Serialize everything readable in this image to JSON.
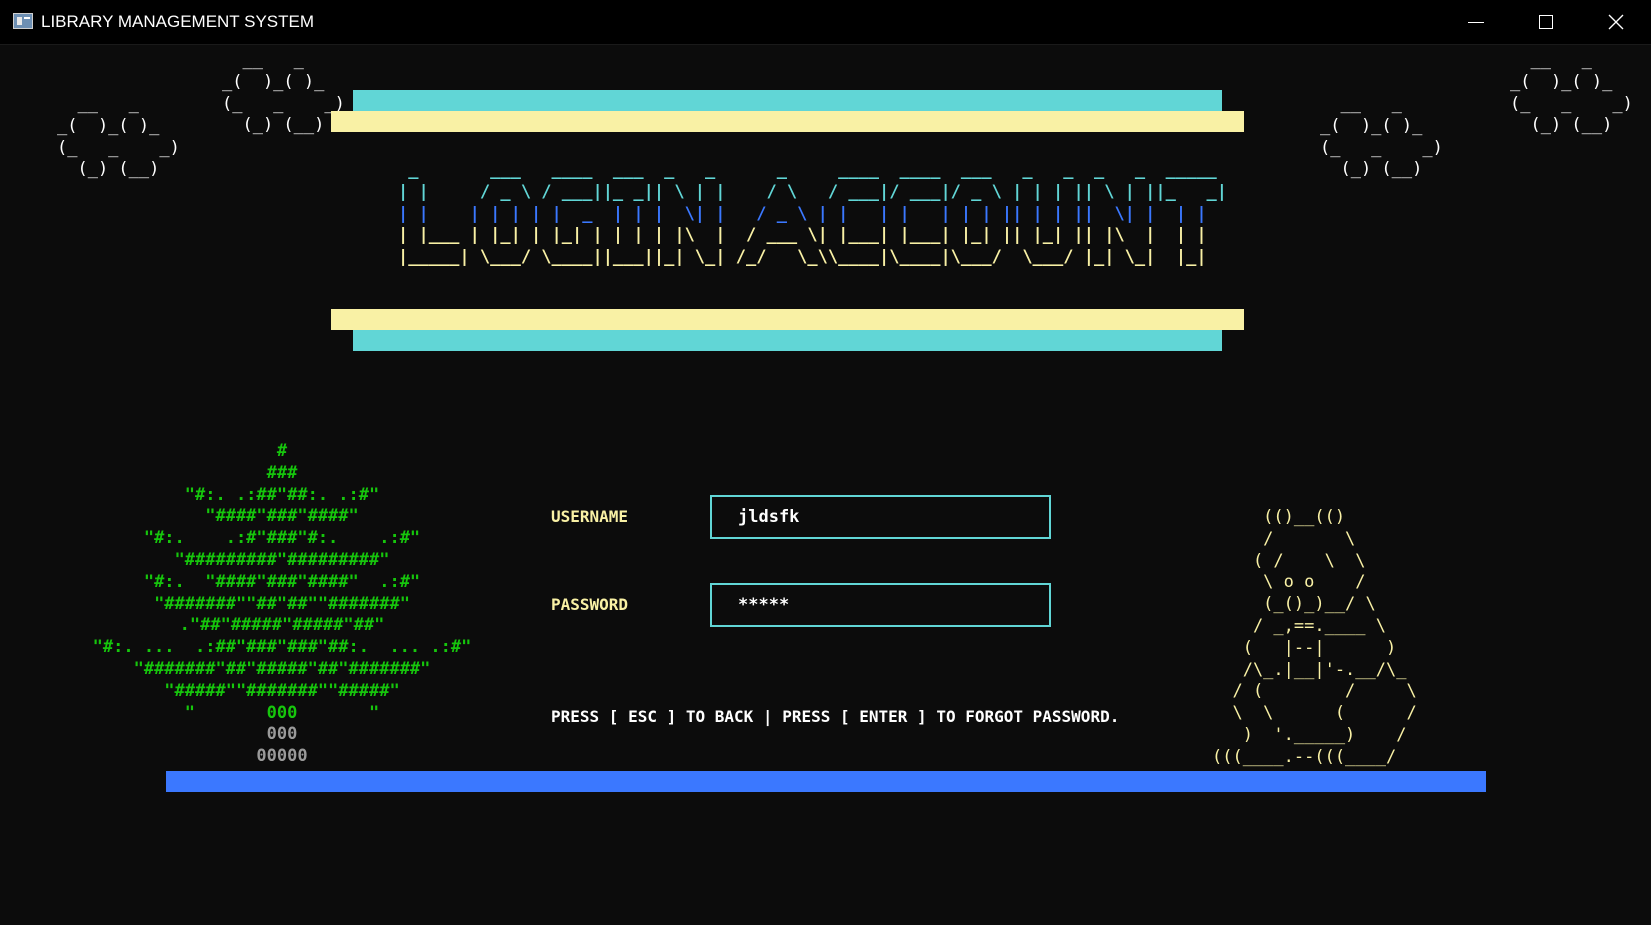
{
  "window": {
    "title": "LIBRARY MANAGEMENT SYSTEM",
    "icon": "console-window-icon",
    "controls": [
      "minimize-icon",
      "maximize-icon",
      "close-icon"
    ]
  },
  "colors": {
    "background": "#0c0c0c",
    "cyan": "#61d6d6",
    "yellow": "#f9f1a5",
    "blue": "#3b78ff",
    "green": "#16c60c",
    "white": "#ffffff",
    "gray": "#9a9a9a"
  },
  "banner": {
    "lines": [
      " _       ___   ____  ___  _   _      _     ____  ____  ___   _   _  _   _  _____ ",
      "| |     / _ \\ / ___||_ _|| \\ | |    / \\   / ___|/ ___|/ _ \\ | | | || \\ | ||_   _|",
      "| |    | | | | |  _  | | |  \\| |   / _ \\ | |   | |   | | | || | | ||  \\| |  | |  ",
      "| |___ | |_| | |_| | | | | |\\  |  / ___ \\| |___| |___| |_| || |_| || |\\  |  | |  ",
      "|_____| \\___/ \\____||___||_| \\_| /_/   \\_\\\\____|\\____|\\___/  \\___/ |_| \\_|  |_|  "
    ]
  },
  "clouds": {
    "small": "  __   _\n_(  )_( )_\n(_   _    _)\n  (_) (__)",
    "large": "    __   _\n  _(  )_( )_\n(_   _    _)\n  (_) (__)"
  },
  "tree": {
    "lines": [
      "#",
      "###",
      "\"#:. .:##\"##:. .:#\"",
      "\"####\"###\"####\"",
      "\"#:.    .:#\"###\"#:.    .:#\"",
      "\"#########\"#########\"",
      "\"#:.  \"####\"###\"####\"  .:#\"",
      "\"#######\"\"##\"##\"\"#######\"",
      ".\"##\"#####\"#####\"##\"",
      "\"#:. ...  .:##\"###\"###\"##:.  ... .:#\"",
      "\"#######\"##\"#####\"##\"#######\"",
      "\"#####\"\"#######\"\"#####\"",
      "\"       000       \""
    ],
    "trunk": [
      "000",
      "00000"
    ]
  },
  "owl": {
    "art": "     (()__(()\n     /       \\\n    ( /    \\  \\\n     \\ o o    /\n     (_()_)__/ \\\n    / _,==.____ \\\n   (   |--|      )\n   /\\_.|__|'-.__/\\_\n  / (        /     \\\n  \\  \\      (      /\n   )  '._____)    /\n(((____.--(((____/"
  },
  "form": {
    "username_label": "USERNAME",
    "username_value": "jldsfk",
    "password_label": "PASSWORD",
    "password_value": "*****",
    "help_text": "PRESS [ ESC ] TO BACK | PRESS [ ENTER ] TO FORGOT PASSWORD."
  }
}
